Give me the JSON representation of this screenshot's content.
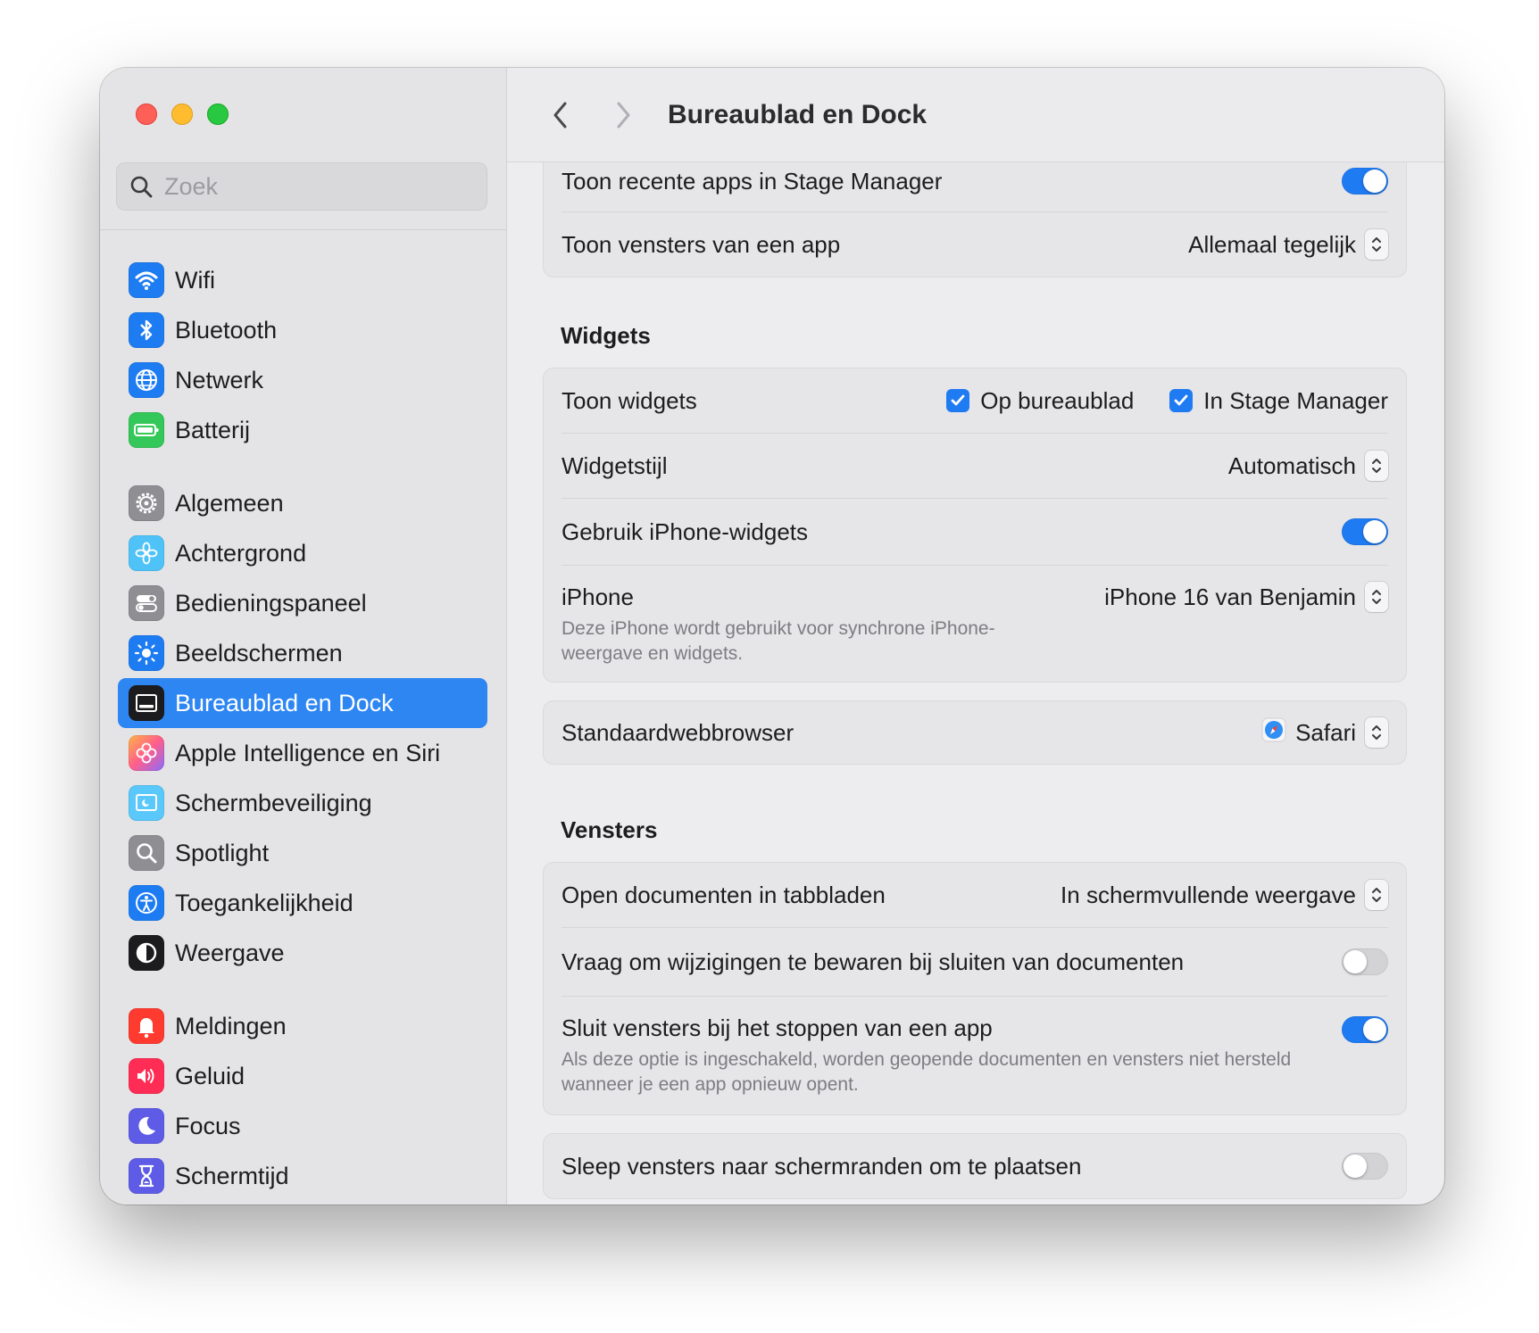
{
  "window": {
    "title": "Bureaublad en Dock"
  },
  "search": {
    "placeholder": "Zoek"
  },
  "sidebar": {
    "groups": [
      [
        {
          "label": "Wifi",
          "icon": "wifi-icon",
          "color": "#1e7cf2"
        },
        {
          "label": "Bluetooth",
          "icon": "bluetooth-icon",
          "color": "#1e7cf2"
        },
        {
          "label": "Netwerk",
          "icon": "globe-icon",
          "color": "#1e7cf2"
        },
        {
          "label": "Batterij",
          "icon": "battery-icon",
          "color": "#34c759"
        }
      ],
      [
        {
          "label": "Algemeen",
          "icon": "gear-icon",
          "color": "#8e8e93"
        },
        {
          "label": "Achtergrond",
          "icon": "flower-icon",
          "color": "#4fc3f7"
        },
        {
          "label": "Bedieningspaneel",
          "icon": "switches-icon",
          "color": "#8e8e93"
        },
        {
          "label": "Beeldschermen",
          "icon": "sun-icon",
          "color": "#1e7cf2"
        },
        {
          "label": "Bureaublad en Dock",
          "icon": "dock-icon",
          "color": "#1c1c1e",
          "active": true
        },
        {
          "label": "Apple Intelligence en Siri",
          "icon": "siri-icon",
          "color": "#ff7a59"
        },
        {
          "label": "Schermbeveiliging",
          "icon": "screensaver-icon",
          "color": "#5ac8fa"
        },
        {
          "label": "Spotlight",
          "icon": "magnifier-icon",
          "color": "#8e8e93"
        },
        {
          "label": "Toegankelijkheid",
          "icon": "accessibility-icon",
          "color": "#1e7cf2"
        },
        {
          "label": "Weergave",
          "icon": "appearance-icon",
          "color": "#1c1c1e"
        }
      ],
      [
        {
          "label": "Meldingen",
          "icon": "bell-icon",
          "color": "#ff3b30"
        },
        {
          "label": "Geluid",
          "icon": "speaker-icon",
          "color": "#ff2d55"
        },
        {
          "label": "Focus",
          "icon": "moon-icon",
          "color": "#5e5ce6"
        },
        {
          "label": "Schermtijd",
          "icon": "hourglass-icon",
          "color": "#5e5ce6"
        }
      ]
    ]
  },
  "stage": {
    "recent_apps_label": "Toon recente apps in Stage Manager",
    "recent_apps_on": true,
    "windows_label": "Toon vensters van een app",
    "windows_value": "Allemaal tegelijk"
  },
  "widgets": {
    "title": "Widgets",
    "show_label": "Toon widgets",
    "on_desktop_label": "Op bureaublad",
    "in_stage_label": "In Stage Manager",
    "style_label": "Widgetstijl",
    "style_value": "Automatisch",
    "iphone_widgets_label": "Gebruik iPhone-widgets",
    "iphone_widgets_on": true,
    "iphone_label": "iPhone",
    "iphone_value": "iPhone 16 van Benjamin",
    "iphone_subtext": "Deze iPhone wordt gebruikt voor synchrone iPhone-weergave en widgets."
  },
  "browser": {
    "label": "Standaardwebbrowser",
    "value": "Safari",
    "icon": "safari-icon"
  },
  "windows": {
    "title": "Vensters",
    "tabs_label": "Open documenten in tabbladen",
    "tabs_value": "In schermvullende weergave",
    "ask_save_label": "Vraag om wijzigingen te bewaren bij sluiten van documenten",
    "ask_save_on": false,
    "close_windows_label": "Sluit vensters bij het stoppen van een app",
    "close_windows_on": true,
    "close_windows_subtext": "Als deze optie is ingeschakeld, worden geopende documenten en vensters niet hersteld wanneer je een app opnieuw opent.",
    "drag_edges_label": "Sleep vensters naar schermranden om te plaatsen",
    "drag_edges_on": false
  },
  "colors": {
    "accent": "#1f7bf2",
    "active_item": "#2e86f2"
  }
}
